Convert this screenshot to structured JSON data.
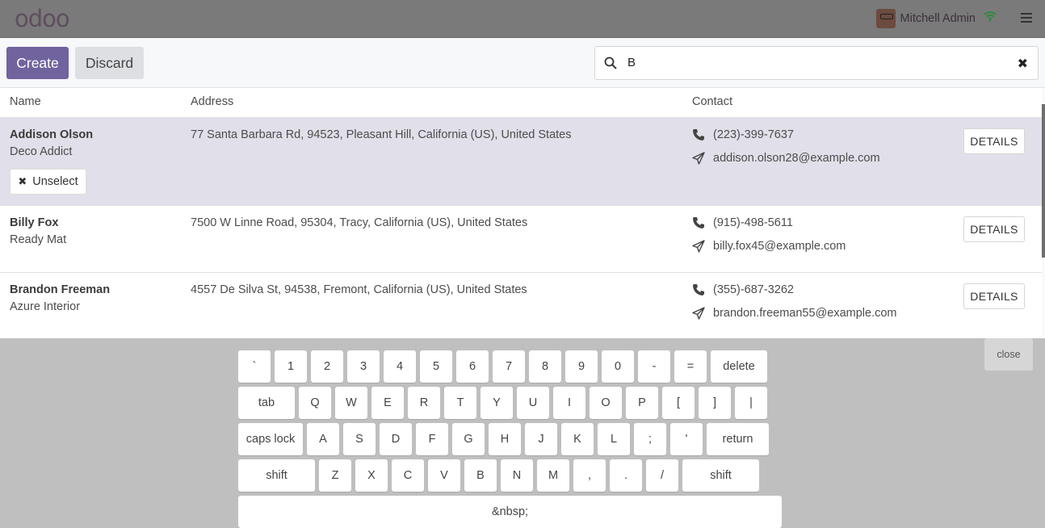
{
  "header": {
    "logo_text": "odoo",
    "user_name": "Mitchell Admin",
    "icons": [
      "avatar",
      "wifi-icon",
      "hamburger-menu-icon"
    ]
  },
  "actions": {
    "create_label": "Create",
    "discard_label": "Discard"
  },
  "search": {
    "value": "B",
    "icon": "search-icon",
    "clear_icon": "close-icon"
  },
  "table": {
    "columns": [
      "Name",
      "Address",
      "Contact"
    ],
    "rows": [
      {
        "name": "Addison Olson",
        "company": "Deco Addict",
        "address": "77 Santa Barbara Rd, 94523, Pleasant Hill, California (US), United States",
        "phone": "(223)-399-7637",
        "email": "addison.olson28@example.com",
        "details_label": "DETAILS",
        "unselect_label": "Unselect",
        "selected": true
      },
      {
        "name": "Billy Fox",
        "company": "Ready Mat",
        "address": "7500 W Linne Road, 95304, Tracy, California (US), United States",
        "phone": "(915)-498-5611",
        "email": "billy.fox45@example.com",
        "details_label": "DETAILS",
        "selected": false
      },
      {
        "name": "Brandon Freeman",
        "company": "Azure Interior",
        "address": "4557 De Silva St, 94538, Fremont, California (US), United States",
        "phone": "(355)-687-3262",
        "email": "brandon.freeman55@example.com",
        "details_label": "DETAILS",
        "selected": false
      }
    ]
  },
  "keyboard": {
    "close_label": "close",
    "row1": [
      "`",
      "1",
      "2",
      "3",
      "4",
      "5",
      "6",
      "7",
      "8",
      "9",
      "0",
      "-",
      "=",
      "delete"
    ],
    "row2": [
      "tab",
      "Q",
      "W",
      "E",
      "R",
      "T",
      "Y",
      "U",
      "I",
      "O",
      "P",
      "[",
      "]",
      "|"
    ],
    "row3": [
      "caps lock",
      "A",
      "S",
      "D",
      "F",
      "G",
      "H",
      "J",
      "K",
      "L",
      ";",
      "'",
      "return"
    ],
    "row4": [
      "shift",
      "Z",
      "X",
      "C",
      "V",
      "B",
      "N",
      "M",
      ",",
      ".",
      "/",
      "shift"
    ],
    "row5": [
      "&nbsp;"
    ]
  },
  "colors": {
    "primary": "#71639e",
    "header_bg": "#7a7a7a",
    "selected_row": "#e1dfe9",
    "keyboard_bg": "#bfbfbf"
  }
}
